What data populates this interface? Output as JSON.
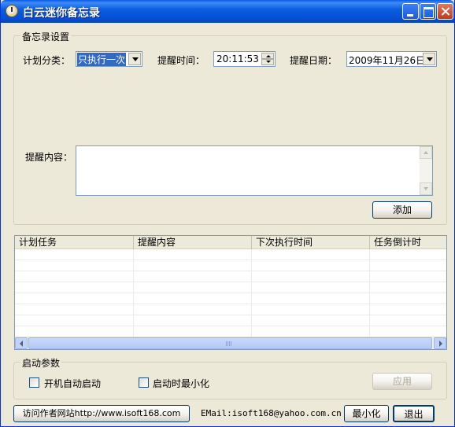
{
  "window": {
    "title": "白云迷你备忘录"
  },
  "settings": {
    "legend": "备忘录设置",
    "category_label": "计划分类：",
    "category_value": "只执行一次",
    "time_label": "提醒时间：",
    "time_value": "20:11:53",
    "date_label": "提醒日期：",
    "date_value": "2009年11月26日",
    "content_label": "提醒内容：",
    "content_value": "",
    "add_label": "添加"
  },
  "task_list": {
    "columns": [
      "计划任务",
      "提醒内容",
      "下次执行时间",
      "任务倒计时"
    ],
    "rows": []
  },
  "params": {
    "legend": "启动参数",
    "autostart_label": "开机自动启动",
    "autostart_checked": false,
    "start_minimized_label": "启动时最小化",
    "start_minimized_checked": false,
    "apply_label": "应用"
  },
  "footer": {
    "visit_label": "访问作者网站http://www.isoft168.com",
    "email_text": "EMail:isoft168@yahoo.com.cn",
    "minimize_label": "最小化",
    "exit_label": "退出"
  }
}
